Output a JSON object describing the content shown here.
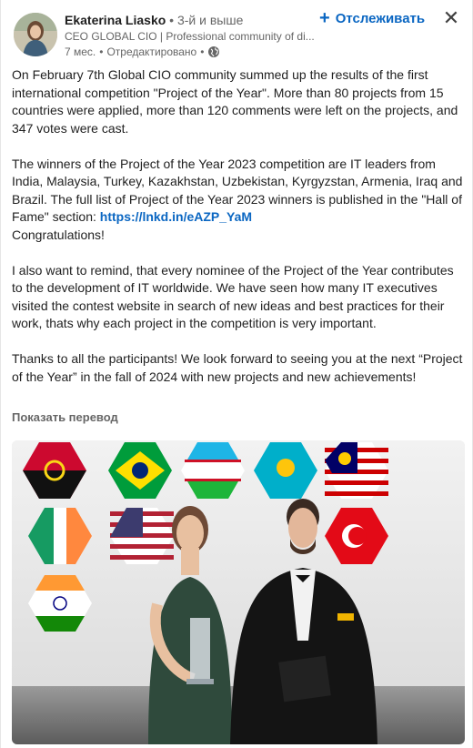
{
  "author": {
    "name": "Ekaterina Liasko",
    "degree": "• 3-й и выше",
    "headline": "CEO GLOBAL CIO | Professional community of di...",
    "time": "7 мес.",
    "separator": "•",
    "edited": "Отредактировано",
    "separator2": "•"
  },
  "actions": {
    "follow_icon": "+",
    "follow_label": "Отслеживать",
    "close_icon": "✕"
  },
  "post": {
    "p1": "On February 7th Global CIO community summed up the results of the first international competition \"Project of the Year\". More than 80 projects from 15 countries were applied, more than 120 comments were left on the projects, and 347 votes were cast.",
    "p2_before_link": "The winners of the Project of the Year 2023 competition are IT leaders from India, Malaysia, Turkey, Kazakhstan, Uzbekistan, Kyrgyzstan, Armenia, Iraq and Brazil. The full list of Project of the Year 2023 winners is published in the \"Hall of Fame\" section: ",
    "p2_link": "https://lnkd.in/eAZP_YaM",
    "p2_after": "Congratulations!",
    "p3": "I also want to remind, that every nominee of the Project of the Year contributes to the development of IT worldwide. We have seen how many IT executives visited the contest website in search of new ideas and best practices for their work, thats why each project in the competition is very important.",
    "p4": "Thanks to all the participants! We look forward to seeing you at the next “Project of the Year” in the fall of 2024 with new projects and new achievements!"
  },
  "translate_label": "Показать перевод",
  "colors": {
    "link": "#0a66c2",
    "text": "#1f1f1f",
    "muted": "#666666"
  },
  "icons": {
    "follow": "plus-icon",
    "close": "close-icon",
    "visibility": "globe-icon"
  }
}
